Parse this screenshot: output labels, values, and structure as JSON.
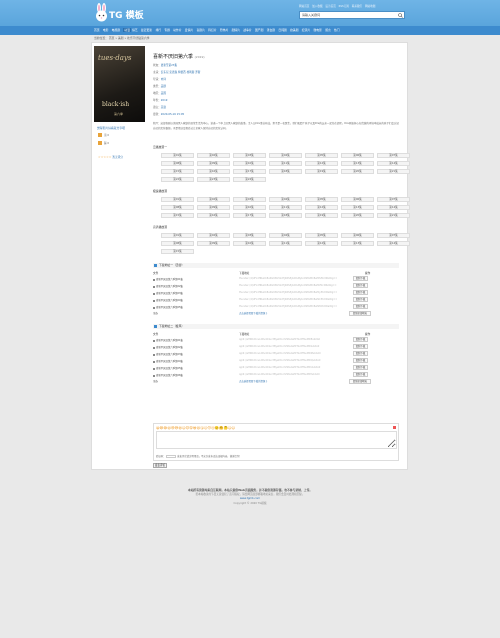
{
  "header": {
    "logo_text": "TG 模板",
    "top_links": [
      "网站首页",
      "加入收藏",
      "设为首页",
      "RSS订阅",
      "联系我们",
      "网站地图"
    ],
    "search": {
      "value": "请输入关键词"
    }
  },
  "nav": {
    "items": [
      "首页",
      "电影",
      "电视剧",
      "动漫",
      "综艺",
      "最近更新",
      "排行",
      "专题",
      "动作片",
      "爱情片",
      "喜剧片",
      "科幻片",
      "恐怖片",
      "剧情片",
      "战争片",
      "国产剧",
      "港台剧",
      "日韩剧",
      "欧美剧",
      "纪录片",
      "微电影",
      "留言",
      "热门"
    ],
    "active_index": 3
  },
  "breadcrumb": "当前位置： 首页 » 美剧 » 欢乐不伏贴第六季",
  "poster": {
    "line1": "tues·days",
    "line2": "black·ish",
    "line3": "第六季"
  },
  "sidebar": {
    "share_link": "觉得影片好看就分享吧",
    "votes": [
      {
        "label": "顶",
        "count": "0",
        "color": "#e8a33a"
      },
      {
        "label": "踩",
        "count": "0",
        "color": "#e8a33a"
      }
    ],
    "stars": "☆☆☆☆☆",
    "rating_text": "暂无评分"
  },
  "movie": {
    "title": "喜新不厌旧第六季",
    "year": "(2019)",
    "info": [
      {
        "k": "状态：",
        "v": "更新至第23集"
      },
      {
        "k": "主演：",
        "v": "安东尼·安德森 特蕾西·埃利斯·罗斯"
      },
      {
        "k": "导演：",
        "v": "内详"
      },
      {
        "k": "类型：",
        "v": "美剧"
      },
      {
        "k": "地区：",
        "v": "美国"
      },
      {
        "k": "年份：",
        "v": "2019"
      },
      {
        "k": "语言：",
        "v": "英语"
      },
      {
        "k": "更新：",
        "v": "2020-05-16 15:05"
      }
    ],
    "description_label": "简介：",
    "description": "这部喜剧以美国黑人家庭的日常生活为中心，讲述一个中上层黑人家庭的故事。主人公Dre事业有成，妻子是一名医生，他们和四个孩子以及Dre的父亲一起住在郊区。Dre开始担心在优越的环境中成长的孩子们会忘记自己的文化根源，于是他决定想办法让全家人保持自己的文化认同。"
  },
  "playlists": [
    {
      "name": "云播放源一",
      "episodes": [
        "第01集",
        "第02集",
        "第03集",
        "第04集",
        "第05集",
        "第06集",
        "第07集",
        "第08集",
        "第09集",
        "第10集",
        "第11集",
        "第12集",
        "第13集",
        "第14集",
        "第15集",
        "第16集",
        "第17集",
        "第18集",
        "第19集",
        "第20集",
        "第21集",
        "第22集",
        "第23集",
        "第24集"
      ]
    },
    {
      "name": "极速播放源",
      "episodes": [
        "第01集",
        "第02集",
        "第03集",
        "第04集",
        "第05集",
        "第06集",
        "第07集",
        "第08集",
        "第09集",
        "第10集",
        "第11集",
        "第12集",
        "第13集",
        "第14集",
        "第15集",
        "第16集",
        "第17集",
        "第18集",
        "第19集",
        "第20集",
        "第21集"
      ]
    },
    {
      "name": "高清播放源",
      "episodes": [
        "第01集",
        "第02集",
        "第03集",
        "第04集",
        "第05集",
        "第06集",
        "第07集",
        "第08集",
        "第09集",
        "第10集",
        "第11集",
        "第12集",
        "第13集",
        "第14集",
        "第15集"
      ]
    }
  ],
  "downloads": [
    {
      "title": "下载地址一（迅雷）",
      "col_file": "文件",
      "col_link": "下载地址",
      "col_op": "操作",
      "rows": [
        {
          "name": "喜新不厌旧第六季第01集",
          "link": "thunder://QUFodHRwOi8vZG93bi5zcHJ4NS5jb20vMjAxOS8xMC8wMS5tcDRaWg==",
          "btn": "复制下载"
        },
        {
          "name": "喜新不厌旧第六季第02集",
          "link": "thunder://QUFodHRwOi8vZG93bi5zcHJ4NS5jb20vMjAxOS8xMC8wMi5tcDRaWg==",
          "btn": "复制下载"
        },
        {
          "name": "喜新不厌旧第六季第03集",
          "link": "thunder://QUFodHRwOi8vZG93bi5zcHJ4NS5jb20vMjAxOS8xMC8wMy5tcDRaWg==",
          "btn": "复制下载"
        },
        {
          "name": "喜新不厌旧第六季第04集",
          "link": "thunder://QUFodHRwOi8vZG93bi5zcHJ4NS5jb20vMjAxOS8xMC8wNC5tcDRaWg==",
          "btn": "复制下载"
        },
        {
          "name": "喜新不厌旧第六季第05集",
          "link": "thunder://QUFodHRwOi8vZG93bi5zcHJ4NS5jb20vMjAxOS8xMC8wNS5tcDRaWg==",
          "btn": "复制下载"
        }
      ],
      "select_all": "全选",
      "hint": "点击选择需要下载的资源 》",
      "copy_all": "复制全部地址"
    },
    {
      "title": "下载地址二（旋风）",
      "col_file": "文件",
      "col_link": "下载地址",
      "col_op": "操作",
      "rows": [
        {
          "name": "喜新不厌旧第六季第01集",
          "link": "qqdl://aHR0cDovL2Rvd24uc3ByeDUuY29tLzIwMTkvMTAvMDEubXA0",
          "btn": "复制下载"
        },
        {
          "name": "喜新不厌旧第六季第02集",
          "link": "qqdl://aHR0cDovL2Rvd24uc3ByeDUuY29tLzIwMTkvMTAvMDIubXA0",
          "btn": "复制下载"
        },
        {
          "name": "喜新不厌旧第六季第03集",
          "link": "qqdl://aHR0cDovL2Rvd24uc3ByeDUuY29tLzIwMTkvMTAvMDMubXA0",
          "btn": "复制下载"
        },
        {
          "name": "喜新不厌旧第六季第04集",
          "link": "qqdl://aHR0cDovL2Rvd24uc3ByeDUuY29tLzIwMTkvMTAvMDQubXA0",
          "btn": "复制下载"
        },
        {
          "name": "喜新不厌旧第六季第05集",
          "link": "qqdl://aHR0cDovL2Rvd24uc3ByeDUuY29tLzIwMTkvMTAvMDUubXA0",
          "btn": "复制下载"
        },
        {
          "name": "喜新不厌旧第六季第06集",
          "link": "qqdl://aHR0cDovL2Rvd24uc3ByeDUuY29tLzIwMTkvMTAvMDYubXA0",
          "btn": "复制下载"
        }
      ],
      "select_all": "全选",
      "hint": "点击选择需要下载的资源 》",
      "copy_all": "复制全部地址"
    }
  ],
  "comment": {
    "emoticons": "😀😁😂😃😄😅😆😉😊😋😎😍😘😗😙😚🙂🤗🤔😐😑",
    "verify_label": "验证码：",
    "info_text": "发表评论请文明用语，不允许发布违法违规内容，谢谢合作！",
    "submit": "发表评论"
  },
  "footer": {
    "line1": "本站所有资源均来自互联网，本站只提供Web页面服务，并不提供资源存储，也不参与录制、上传。",
    "line2": "若本站收录的节目无意侵犯了贵司版权，请给网页底部邮箱地址来信，我们会及时处理和回复。",
    "line3": "www.tgmb.com",
    "line4": "Copyright © 2020 TG模板"
  }
}
